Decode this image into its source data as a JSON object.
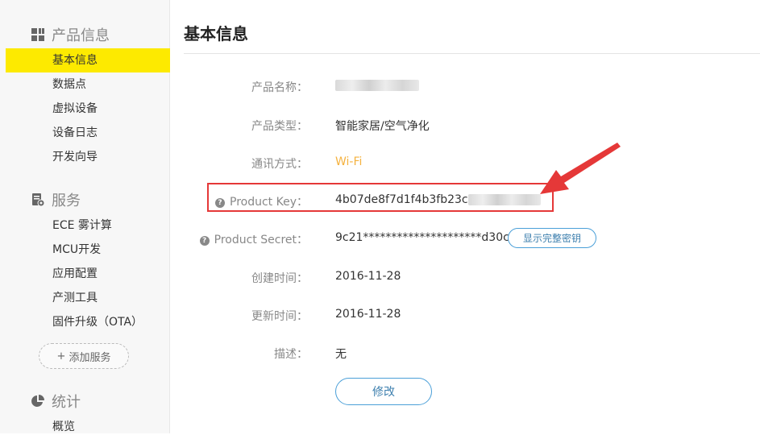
{
  "sidebar": {
    "sections": [
      {
        "title": "产品信息",
        "icon": "grid-icon",
        "items": [
          "基本信息",
          "数据点",
          "虚拟设备",
          "设备日志",
          "开发向导"
        ]
      },
      {
        "title": "服务",
        "icon": "settings-doc-icon",
        "items": [
          "ECE 雾计算",
          "MCU开发",
          "应用配置",
          "产测工具",
          "固件升级（OTA）"
        ],
        "add_label": "添加服务"
      },
      {
        "title": "统计",
        "icon": "pie-chart-icon",
        "items": [
          "概览"
        ]
      }
    ],
    "active_item": "基本信息"
  },
  "main": {
    "title": "基本信息",
    "fields": {
      "product_name": {
        "label": "产品名称："
      },
      "product_type": {
        "label": "产品类型：",
        "value": "智能家居/空气净化"
      },
      "comm_method": {
        "label": "通讯方式：",
        "value": "Wi-Fi"
      },
      "product_key": {
        "label": "Product Key：",
        "value": "4b07de8f7d1f4b3fb23c"
      },
      "product_secret": {
        "label": "Product Secret：",
        "value": "9c21*********************d30c",
        "button": "显示完整密钥"
      },
      "created": {
        "label": "创建时间：",
        "value": "2016-11-28"
      },
      "updated": {
        "label": "更新时间：",
        "value": "2016-11-28"
      },
      "description": {
        "label": "描述：",
        "value": "无"
      }
    },
    "edit_button": "修改"
  },
  "colors": {
    "active_bg": "#fdea00",
    "highlight": "#e53838",
    "wifi": "#f5b23f",
    "button_border": "#4a9fd8"
  }
}
